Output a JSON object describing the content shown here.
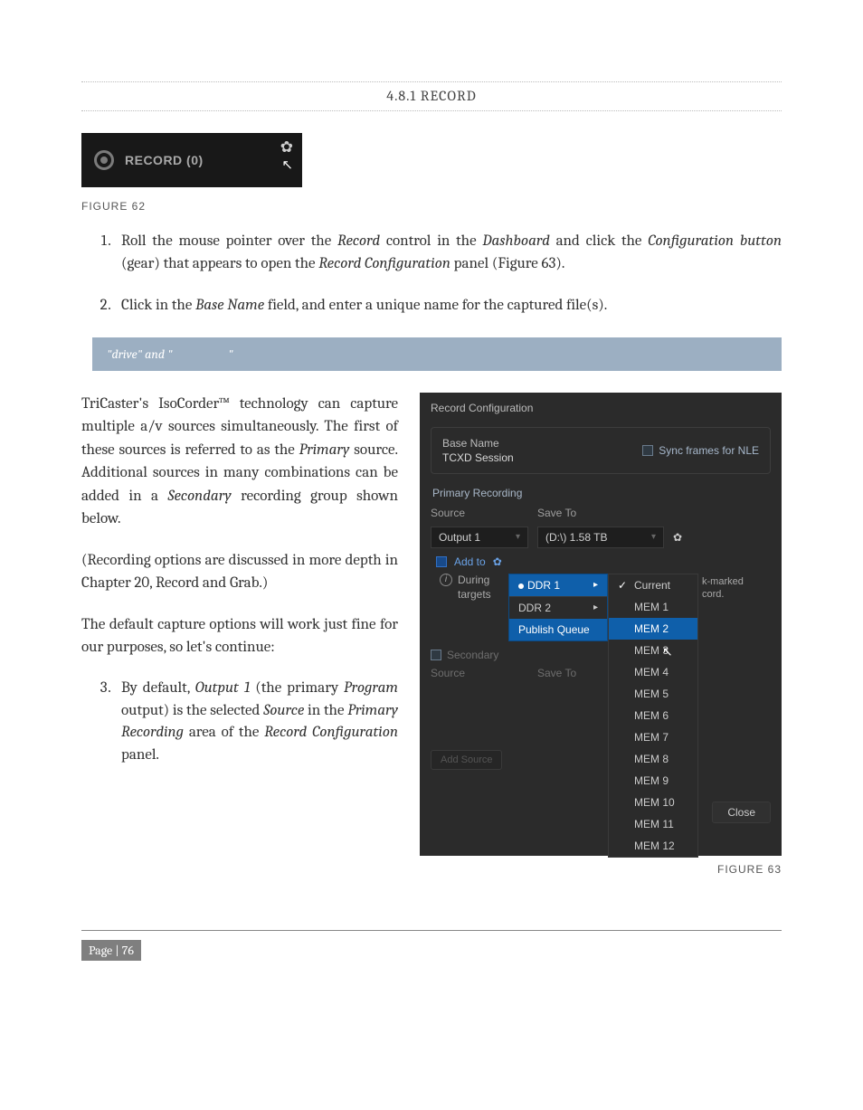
{
  "section": {
    "heading": "4.8.1  RECORD"
  },
  "record_widget": {
    "label": "RECORD (0)"
  },
  "figure62_caption": "FIGURE 62",
  "step1": {
    "pre": "Roll the mouse pointer over the ",
    "em1": "Record",
    "mid1": " control in the ",
    "em2": "Dashboard",
    "mid2": " and click the ",
    "em3": "Configuration button",
    "mid3": " (gear) that appears to open the ",
    "em4": "Record Configuration",
    "post": " panel (Figure 63)."
  },
  "step2": {
    "pre": "Click in the ",
    "em1": "Base Name",
    "post": " field, and enter a unique name for the captured file(s)."
  },
  "hint": {
    "left": "\"drive\" and \" ",
    "right": "\""
  },
  "para1": {
    "pre": "TriCaster's IsoCorder™ technology can capture multiple a/v sources simultaneously.  The first of these sources is referred to as the ",
    "em1": "Primary",
    "mid1": " source. Additional sources in many combinations can be added in a ",
    "em2": "Secondary",
    "post": " recording group shown below."
  },
  "para2": "(Recording options are discussed in more depth in Chapter 20, Record and Grab.)",
  "para3": "The default capture options will work just fine for our purposes, so let's continue:",
  "step3": {
    "pre": "By default, ",
    "em1": "Output 1",
    "mid1": " (the primary ",
    "em2": "Program",
    "mid2": " output) is the selected ",
    "em3": "Source",
    "mid3": " in the ",
    "em4": "Primary Recording",
    "mid4": " area of the ",
    "em5": "Record Configuration",
    "post": " panel."
  },
  "dialog": {
    "title": "Record Configuration",
    "base_name_label": "Base Name",
    "base_name_value": "TCXD Session",
    "sync_label": "Sync frames for NLE",
    "primary_title": "Primary Recording",
    "source_hdr": "Source",
    "saveto_hdr": "Save To",
    "source_value": "Output 1",
    "saveto_value": "(D:\\) 1.58 TB",
    "addto_label": "Add to",
    "during_label": "During",
    "targets_label": "targets",
    "menu1": {
      "ddr1": "DDR 1",
      "ddr2": "DDR 2",
      "pq": "Publish Queue"
    },
    "menu2": {
      "current": "Current",
      "items": [
        "MEM 1",
        "MEM 2",
        "MEM 3",
        "MEM 4",
        "MEM 5",
        "MEM 6",
        "MEM 7",
        "MEM 8",
        "MEM 9",
        "MEM 10",
        "MEM 11",
        "MEM 12"
      ]
    },
    "right_notes": {
      "line1": "k-marked",
      "line2": "cord."
    },
    "secondary_label": "Secondary",
    "source2_hdr": "Source",
    "saveto2_hdr": "Save To",
    "add_source_btn": "Add Source",
    "close_btn": "Close"
  },
  "figure63_caption": "FIGURE 63",
  "page_label": "Page | 76"
}
